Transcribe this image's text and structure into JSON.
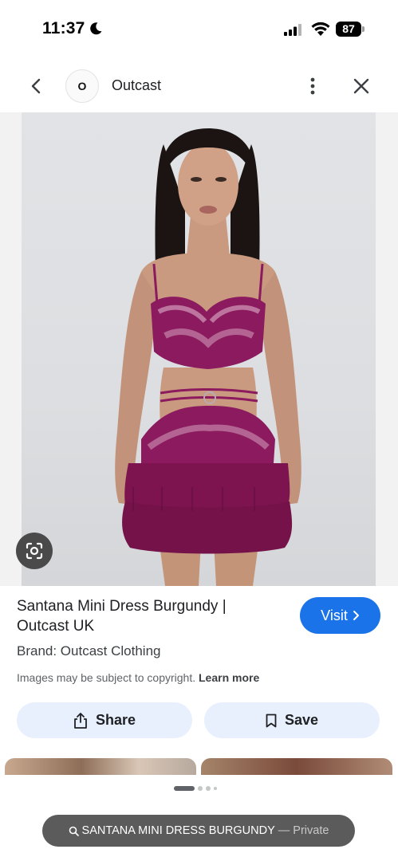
{
  "status_bar": {
    "time": "11:37",
    "battery": "87",
    "icons": [
      "moon-icon",
      "signal-icon",
      "wifi-icon",
      "battery-icon"
    ]
  },
  "header": {
    "site_avatar_letter": "O",
    "site_name": "Outcast",
    "icons": [
      "back-arrow-icon",
      "more-vert-icon",
      "close-icon"
    ]
  },
  "result": {
    "title": "Santana Mini Dress Burgundy | Outcast UK",
    "visit_label": "Visit",
    "brand": "Brand: Outcast Clothing",
    "copyright_text": "Images may be subject to copyright.",
    "learn_more": "Learn more",
    "share_label": "Share",
    "save_label": "Save"
  },
  "pager": {
    "count": 4,
    "active": 0
  },
  "url_bar": {
    "query": "SANTANA MINI DRESS BURGUNDY",
    "mode": "— Private"
  },
  "colors": {
    "accent": "#1a73e8",
    "action_bg": "#e8f0fe",
    "dress": "#8b1a5e"
  }
}
